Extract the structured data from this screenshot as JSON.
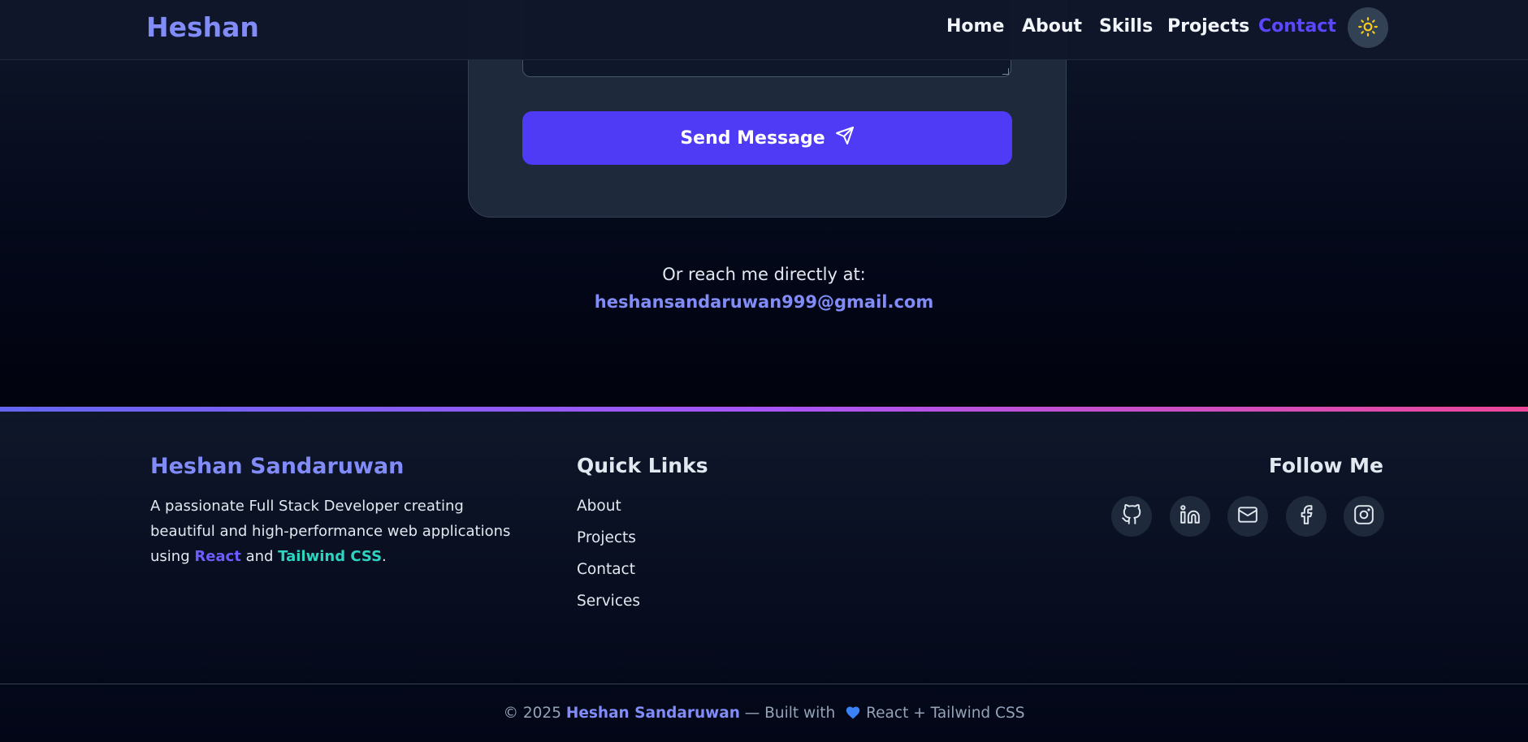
{
  "nav": {
    "brand": "Heshan",
    "links": [
      "Home",
      "About",
      "Skills",
      "Projects",
      "Contact"
    ],
    "active": "Contact",
    "theme_toggle_icon": "sun-icon"
  },
  "contact": {
    "send_label": "Send Message",
    "send_icon": "send-icon",
    "reach_label": "Or reach me directly at:",
    "email": "heshansandaruwan999@gmail.com"
  },
  "footer": {
    "name": "Heshan Sandaruwan",
    "desc_before": "A passionate Full Stack Developer creating beautiful and high-performance web applications using ",
    "desc_react": "React",
    "desc_and": " and ",
    "desc_tailwind": "Tailwind CSS",
    "desc_end": ".",
    "quick_links_title": "Quick Links",
    "quick_links": [
      "About",
      "Projects",
      "Contact",
      "Services"
    ],
    "follow_title": "Follow Me",
    "socials": [
      "github-icon",
      "linkedin-icon",
      "mail-icon",
      "facebook-icon",
      "instagram-icon"
    ],
    "copyright_prefix": "© 2025 ",
    "copyright_name": "Heshan Sandaruwan",
    "copyright_mid": " — Built with ",
    "copyright_suffix": "React + Tailwind CSS"
  },
  "colors": {
    "accent": "#818cf8",
    "button": "#4f3bf6",
    "active_link": "#5b47ff",
    "tailwind_highlight": "#2dd4bf",
    "sun": "#facc15",
    "heart": "#3b82f6"
  }
}
